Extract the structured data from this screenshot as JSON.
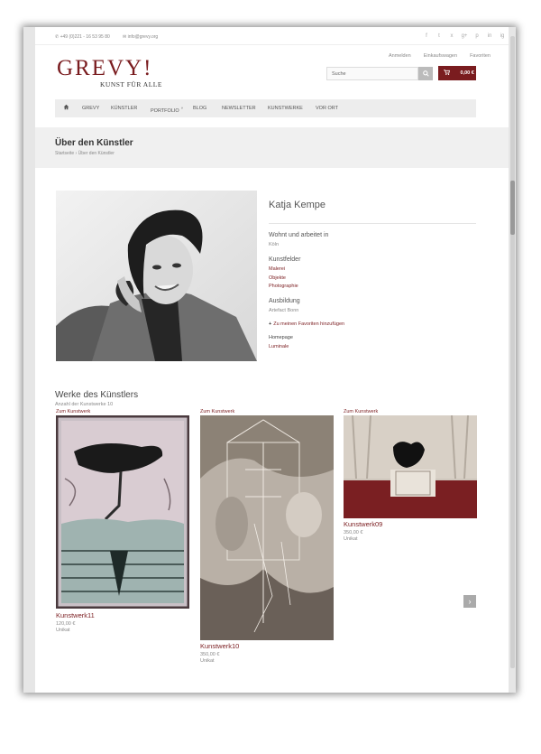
{
  "topbar": {
    "phone": "+49 (0)221 - 16 53 95 80",
    "email": "info@grevy.org",
    "socials": [
      "f",
      "t",
      "x",
      "g+",
      "p",
      "in",
      "ig"
    ]
  },
  "brand": {
    "logo": "GREVY!",
    "slogan": "KUNST FÜR ALLE",
    "accent": "#7a1c1f"
  },
  "account": {
    "login": "Anmelden",
    "cart": "Einkaufswagen",
    "favorites": "Favoriten"
  },
  "search": {
    "placeholder": "Suche"
  },
  "cart": {
    "total": "0,00 €"
  },
  "nav": {
    "items": [
      "GREVY",
      "KÜNSTLER",
      "PORTFOLIO",
      "BLOG",
      "NEWSLETTER",
      "KUNSTWERKE",
      "VOR ORT"
    ]
  },
  "page": {
    "title": "Über den Künstler",
    "crumb_home": "Startseite",
    "crumb_sep": "›",
    "crumb_current": "Über den Künstler"
  },
  "artist": {
    "name": "Katja Kempe",
    "lives_label": "Wohnt und arbeitet in",
    "lives_value": "Köln",
    "fields_label": "Kunstfelder",
    "fields": [
      "Malerei",
      "Objekte",
      "Photographie"
    ],
    "education_label": "Ausbildung",
    "education_value": "Artefact Bonn",
    "fav_plus": "+",
    "fav_link": "Zu meinen Favoriten hinzufügen",
    "homepage_label": "Homepage",
    "homepage_value": "Luminale"
  },
  "works": {
    "title": "Werke des Künstlers",
    "count": "Anzahl der Kunstwerke 10",
    "items": [
      {
        "link": "Zum Kunstwerk",
        "name": "Kunstwerk11",
        "price": "120,00 €",
        "type": "Unikat"
      },
      {
        "link": "Zum Kunstwerk",
        "name": "Kunstwerk10",
        "price": "350,00 €",
        "type": "Unikat"
      },
      {
        "link": "Zum Kunstwerk",
        "name": "Kunstwerk09",
        "price": "350,00 €",
        "type": "Unikat"
      }
    ],
    "next": "›"
  }
}
